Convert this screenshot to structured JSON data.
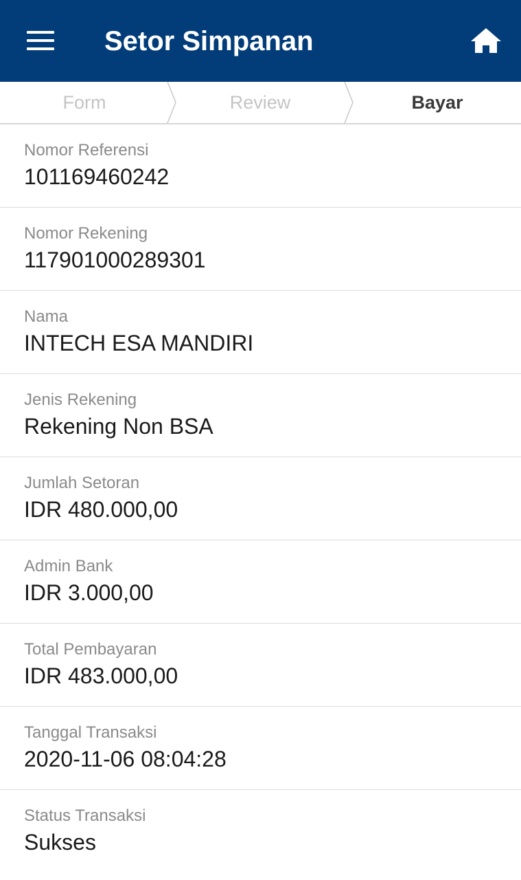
{
  "header": {
    "title": "Setor Simpanan",
    "menu_icon": "hamburger-menu-icon",
    "home_icon": "home-icon",
    "bg_color": "#023d7a"
  },
  "steps": [
    {
      "label": "Form",
      "active": false
    },
    {
      "label": "Review",
      "active": false
    },
    {
      "label": "Bayar",
      "active": true
    }
  ],
  "details": [
    {
      "label": "Nomor Referensi",
      "value": "101169460242"
    },
    {
      "label": "Nomor Rekening",
      "value": "117901000289301"
    },
    {
      "label": "Nama",
      "value": "INTECH ESA MANDIRI"
    },
    {
      "label": "Jenis Rekening",
      "value": "Rekening Non BSA"
    },
    {
      "label": "Jumlah Setoran",
      "value": "IDR 480.000,00"
    },
    {
      "label": "Admin Bank",
      "value": "IDR 3.000,00"
    },
    {
      "label": "Total Pembayaran",
      "value": "IDR 483.000,00"
    },
    {
      "label": "Tanggal Transaksi",
      "value": "2020-11-06 08:04:28"
    },
    {
      "label": "Status Transaksi",
      "value": "Sukses"
    }
  ]
}
